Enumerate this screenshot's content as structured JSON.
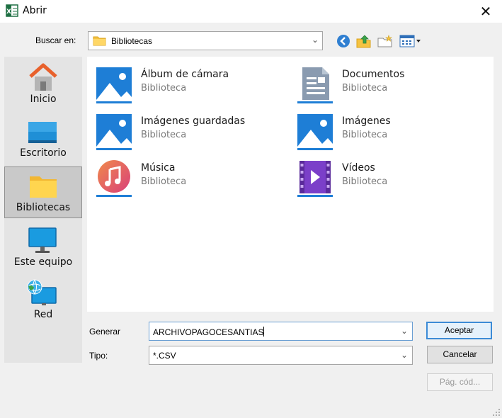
{
  "window": {
    "title": "Abrir",
    "close_label": "✕"
  },
  "toolbar": {
    "look_in_label": "Buscar en:",
    "look_in_value": "Bibliotecas",
    "buttons": [
      "back-icon",
      "up-folder-icon",
      "new-folder-icon",
      "view-menu-icon"
    ]
  },
  "places": [
    {
      "label": "Inicio",
      "icon": "home-icon",
      "selected": false
    },
    {
      "label": "Escritorio",
      "icon": "desktop-icon",
      "selected": false
    },
    {
      "label": "Bibliotecas",
      "icon": "libraries-folder-icon",
      "selected": true
    },
    {
      "label": "Este equipo",
      "icon": "computer-icon",
      "selected": false
    },
    {
      "label": "Red",
      "icon": "network-icon",
      "selected": false
    }
  ],
  "files": [
    {
      "name": "Álbum de cámara",
      "type": "Biblioteca",
      "icon": "pictures-library-icon"
    },
    {
      "name": "Documentos",
      "type": "Biblioteca",
      "icon": "documents-library-icon"
    },
    {
      "name": "Imágenes guardadas",
      "type": "Biblioteca",
      "icon": "pictures-library-icon"
    },
    {
      "name": "Imágenes",
      "type": "Biblioteca",
      "icon": "pictures-library-icon"
    },
    {
      "name": "Música",
      "type": "Biblioteca",
      "icon": "music-library-icon"
    },
    {
      "name": "Vídeos",
      "type": "Biblioteca",
      "icon": "videos-library-icon"
    }
  ],
  "form": {
    "filename_label": "Generar",
    "filename_value": "ARCHIVOPAGOCESANTIAS",
    "type_label": "Tipo:",
    "type_value": "*.CSV"
  },
  "buttons": {
    "accept": "Aceptar",
    "cancel": "Cancelar",
    "codepage": "Pág. cód..."
  },
  "colors": {
    "accent": "#3c8bd6",
    "window_bg": "#f0f0f0",
    "list_bg": "#ffffff",
    "places_bg": "#e4e4e4",
    "secondary_text": "#7a7a7a"
  }
}
